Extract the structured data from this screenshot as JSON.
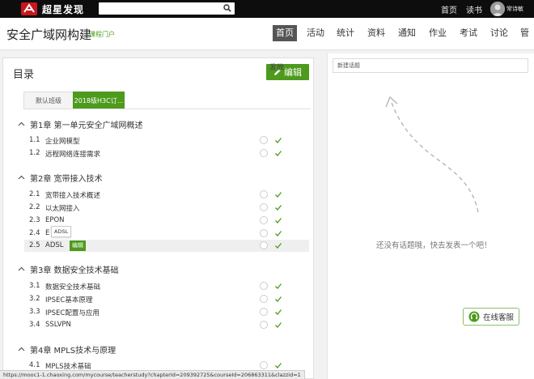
{
  "topbar": {
    "logo_text": "超星发现",
    "links": {
      "home": "首页",
      "reading": "读书"
    },
    "user_name": "常诗敏"
  },
  "course": {
    "title": "安全广域网构建",
    "portal": "课程门户",
    "nav": [
      "首页",
      "活动",
      "统计",
      "资料",
      "通知",
      "作业",
      "考试",
      "讨论",
      "管"
    ]
  },
  "directory": {
    "title": "目录",
    "edit_label": "编辑",
    "tabs": [
      "默认班级",
      "2018级H3C订..."
    ],
    "publish_header": "发放",
    "tooltip": "ADSL",
    "row_badge": "编辑",
    "chapters": [
      {
        "label": "第1章 第一单元安全广域网概述",
        "sections": [
          {
            "num": "1.1",
            "title": "企业网模型"
          },
          {
            "num": "1.2",
            "title": "远程网络连接需求"
          }
        ]
      },
      {
        "label": "第2章 宽带接入技术",
        "sections": [
          {
            "num": "2.1",
            "title": "宽带接入技术概述"
          },
          {
            "num": "2.2",
            "title": "以太网接入"
          },
          {
            "num": "2.3",
            "title": "EPON"
          },
          {
            "num": "2.4",
            "title": "E"
          },
          {
            "num": "2.5",
            "title": "ADSL"
          }
        ]
      },
      {
        "label": "第3章 数据安全技术基础",
        "sections": [
          {
            "num": "3.1",
            "title": "数据安全技术基础"
          },
          {
            "num": "3.2",
            "title": "IPSEC基本原理"
          },
          {
            "num": "3.3",
            "title": "IPSEC配置与应用"
          },
          {
            "num": "3.4",
            "title": "SSLVPN"
          }
        ]
      },
      {
        "label": "第4章 MPLS技术与原理",
        "sections": [
          {
            "num": "4.1",
            "title": "MPLS技术基础"
          }
        ]
      }
    ]
  },
  "discussion": {
    "new_topic": "新建话题",
    "empty_text": "还没有话题哦，快去发表一个吧！"
  },
  "service": {
    "label": "在线客服"
  },
  "status_url": "https://mooc1-1.chaoxing.com/mycourse/teacherstudy?chapterId=209392725&courseId=206863311&clazzid=1",
  "colors": {
    "accent": "#4d9a1c",
    "topbar": "#0d0d0d",
    "nav_active": "#555555"
  }
}
